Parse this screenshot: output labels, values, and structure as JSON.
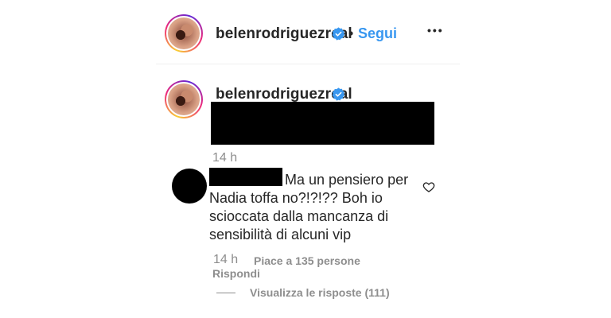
{
  "header": {
    "username": "belenrodriguezreal",
    "separator": "•",
    "follow_label": "Segui",
    "more_label": "•••"
  },
  "caption": {
    "username": "belenrodriguezreal",
    "timestamp": "14 h"
  },
  "comment": {
    "text": "Ma un pensiero per Nadia toffa no?!?!?? Boh io scioccata dalla mancanza di sensibilità di alcuni vip",
    "timestamp": "14 h",
    "likes_label": "Piace a 135 persone",
    "reply_label": "Rispondi",
    "view_replies_label": "Visualizza le risposte (111)"
  },
  "colors": {
    "link": "#3897f0",
    "text": "#262626",
    "muted": "#8e8e8e",
    "verified": "#3897f0"
  },
  "icons": {
    "verified": "verified-badge-icon",
    "heart": "heart-icon",
    "more": "more-options-icon"
  }
}
